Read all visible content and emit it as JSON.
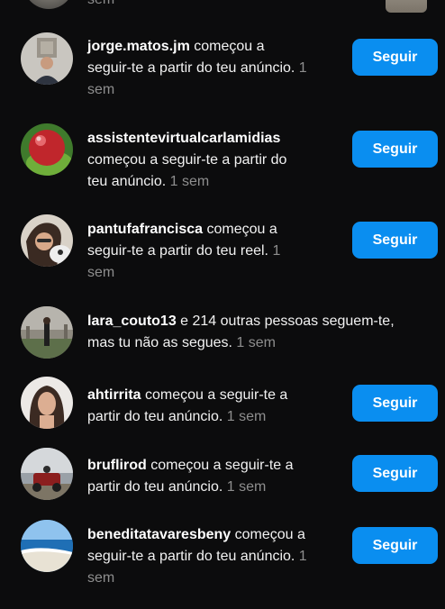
{
  "top_partial": {
    "time": "sem"
  },
  "notifications": [
    {
      "username": "jorge.matos.jm",
      "line1_rest": " começou a",
      "line2": "seguir-te a partir do teu anúncio.",
      "line2_time": " 1",
      "line3_time": "sem",
      "button": "Seguir"
    },
    {
      "username": "assistentevirtualcarlamidias",
      "line2": "começou a seguir-te a partir do",
      "line3": "teu anúncio.",
      "time": " 1 sem",
      "button": "Seguir"
    },
    {
      "username": "pantufafrancisca",
      "line1_rest": " começou a",
      "line2": "seguir-te a partir do teu reel.",
      "line2_time": " 1",
      "line3_time": "sem",
      "button": "Seguir"
    },
    {
      "username": "lara_couto13",
      "line1_rest": " e 214 outras pessoas seguem-te,",
      "line2": "mas tu não as segues.",
      "time": " 1 sem"
    },
    {
      "username": "ahtirrita",
      "line1_rest": " começou a seguir-te a",
      "line2": "partir do teu anúncio.",
      "time": " 1 sem",
      "button": "Seguir"
    },
    {
      "username": "bruflirod",
      "line1_rest": " começou a seguir-te a",
      "line2": "partir do teu anúncio.",
      "time": " 1 sem",
      "button": "Seguir"
    },
    {
      "username": "beneditatavaresbeny",
      "line1_rest": " começou a",
      "line2": "seguir-te a partir do teu anúncio.",
      "line2_time": " 1",
      "line3_time": "sem",
      "button": "Seguir"
    }
  ]
}
